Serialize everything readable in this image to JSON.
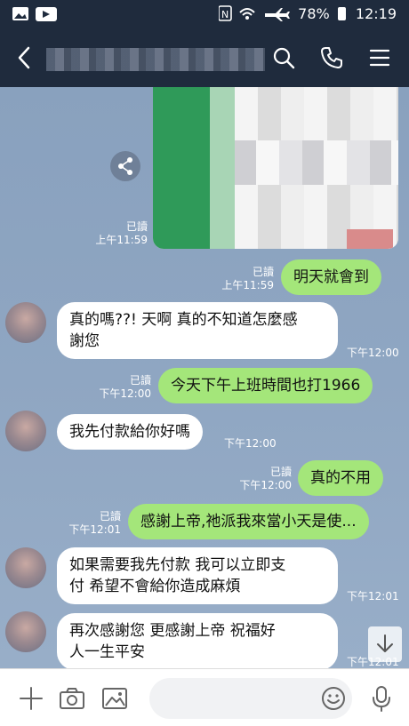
{
  "status_bar": {
    "battery": "78%",
    "time": "12:19"
  },
  "chat": {
    "image_message": {
      "read": "已讀",
      "time": "上午11:59"
    },
    "messages": [
      {
        "side": "sent",
        "text": "明天就會到",
        "read": "已讀",
        "time": "上午11:59"
      },
      {
        "side": "recv",
        "line1": "真的嗎??! 天啊 真的不知道怎麼感",
        "line2": "謝您",
        "time": "下午12:00"
      },
      {
        "side": "sent",
        "text": "今天下午上班時間也打1966",
        "read": "已讀",
        "time": "下午12:00"
      },
      {
        "side": "recv",
        "line1": "我先付款給你好嗎",
        "time": "下午12:00"
      },
      {
        "side": "sent",
        "text": "真的不用",
        "read": "已讀",
        "time": "下午12:00"
      },
      {
        "side": "sent",
        "text": "感謝上帝,祂派我來當小天是使...",
        "read": "已讀",
        "time": "下午12:01"
      },
      {
        "side": "recv",
        "line1": "如果需要我先付款 我可以立即支",
        "line2": "付 希望不會給你造成麻煩",
        "time": "下午12:01"
      },
      {
        "side": "recv",
        "line1": "再次感謝您  更感謝上帝   祝福好",
        "line2": "人一生平安",
        "time": "下午12:01"
      }
    ]
  },
  "icons": {
    "back": "back-arrow-icon",
    "search": "search-icon",
    "call": "phone-icon",
    "menu": "menu-icon",
    "share": "share-icon",
    "scroll": "arrow-down-icon",
    "add": "plus-icon",
    "camera": "camera-icon",
    "gallery": "image-icon",
    "emoji": "emoji-icon",
    "mic": "microphone-icon"
  },
  "colors": {
    "header": "#1f2b3d",
    "sent_bubble": "#a4e67a",
    "recv_bubble": "#ffffff"
  }
}
